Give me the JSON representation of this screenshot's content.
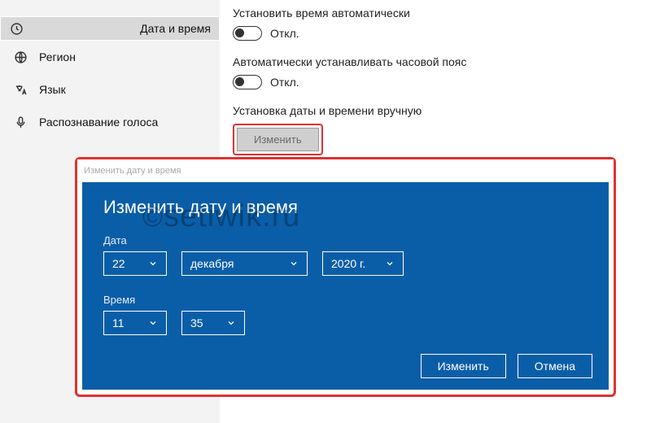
{
  "sidebar": {
    "items": [
      {
        "label": "Дата и время"
      },
      {
        "label": "Регион"
      },
      {
        "label": "Язык"
      },
      {
        "label": "Распознавание голоса"
      }
    ]
  },
  "settings": {
    "auto_time_title": "Установить время автоматически",
    "auto_time_state": "Откл.",
    "auto_tz_title": "Автоматически устанавливать часовой пояс",
    "auto_tz_state": "Откл.",
    "manual_title": "Установка даты и времени вручную",
    "change_button": "Изменить"
  },
  "dialog": {
    "window_title": "Изменить дату и время",
    "title": "Изменить дату и время",
    "date_label": "Дата",
    "day": "22",
    "month": "декабря",
    "year": "2020 г.",
    "time_label": "Время",
    "hour": "11",
    "minute": "35",
    "ok": "Изменить",
    "cancel": "Отмена"
  },
  "watermark": "setiwik.ru"
}
